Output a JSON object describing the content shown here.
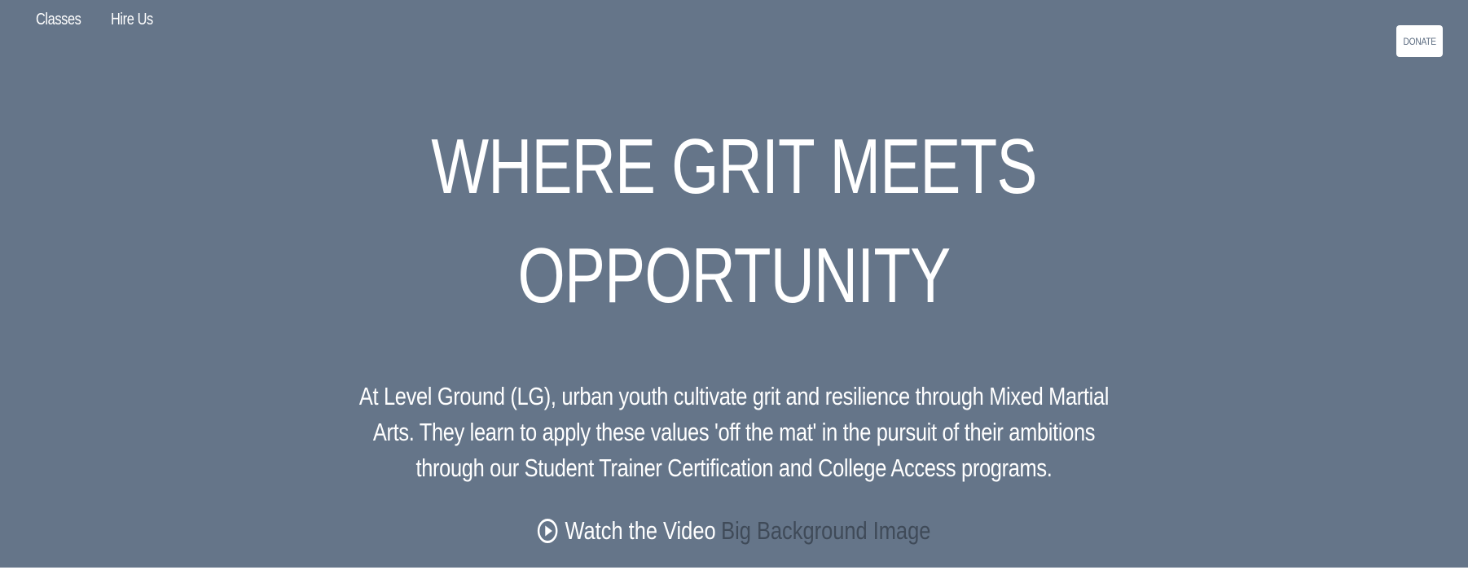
{
  "nav": {
    "items": [
      {
        "label": "Classes"
      },
      {
        "label": "Hire Us"
      }
    ]
  },
  "donate_label": "DONATE",
  "hero": {
    "headline_line1": "WHERE GRIT MEETS",
    "headline_line2": "OPPORTUNITY",
    "intro": "At Level Ground (LG), urban youth cultivate grit and resilience through Mixed Martial Arts. They learn to apply these values 'off the mat' in the pursuit of their ambitions through our Student Trainer Certification and College Access programs.",
    "video_label": "Watch the Video",
    "background_alt": "Big Background Image"
  },
  "colors": {
    "hero_background": "#657589",
    "text": "#ffffff",
    "alt_text": "#3f4a58"
  },
  "icons": {
    "video": "play-circle-icon"
  }
}
